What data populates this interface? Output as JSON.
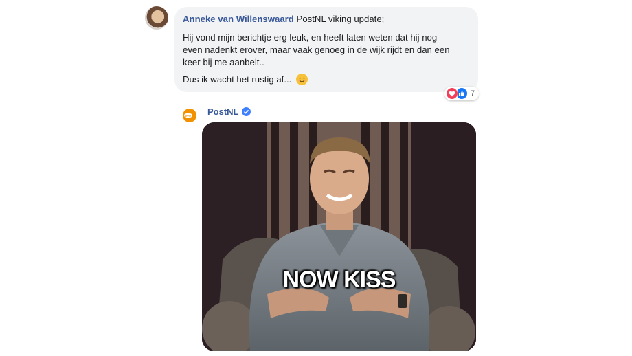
{
  "comment": {
    "author": "Anneke van Willenswaard",
    "text_line1": "PostNL viking update;",
    "paragraph1": "Hij vond mijn berichtje erg leuk, en heeft laten weten dat hij nog\neven nadenkt erover, maar vaak genoeg in de wijk rijdt en dan een\nkeer bij me aanbelt..",
    "paragraph2": "Dus ik wacht het rustig af...",
    "emoji": "smiling-face-emoji",
    "reactions": {
      "count": "7",
      "types": [
        "love",
        "like"
      ]
    }
  },
  "reply": {
    "author": "PostNL",
    "verified": true,
    "gif_caption": "NOW KISS"
  },
  "colors": {
    "link": "#385898",
    "bubble": "#f2f3f5",
    "love": "#f33e58",
    "like": "#1877f2",
    "postnl_orange": "#f39200"
  }
}
